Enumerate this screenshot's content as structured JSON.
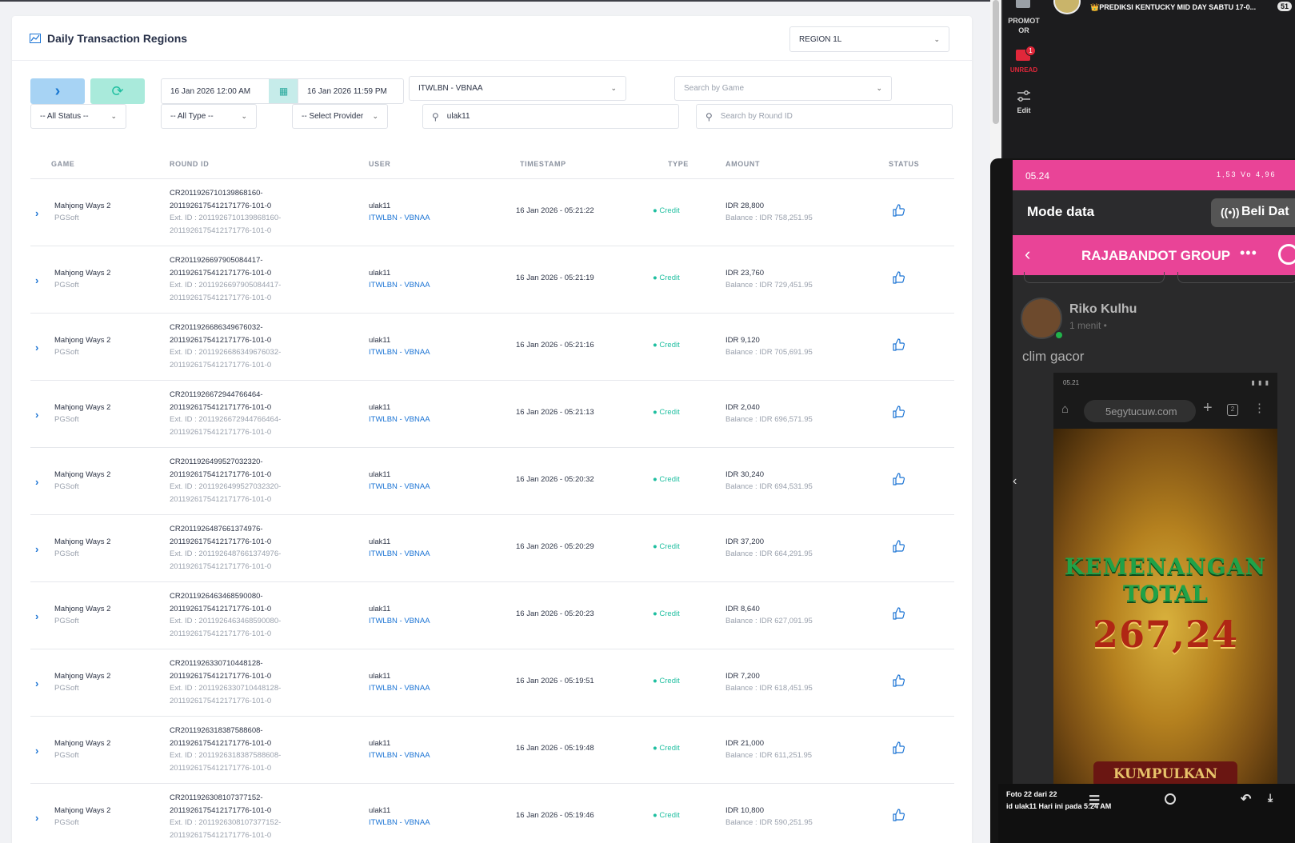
{
  "panel": {
    "title": "Daily Transaction Regions",
    "region_select": "REGION 1L"
  },
  "filters": {
    "date_start": "16 Jan 2026 12:00 AM",
    "date_end": "16 Jan 2026 11:59 PM",
    "agent_select": "ITWLBN - VBNAA",
    "game_search_placeholder": "Search by Game",
    "status_select": "-- All Status --",
    "type_select": "-- All Type --",
    "provider_select": "-- Select Provider",
    "user_search_value": "ulak11",
    "round_search_placeholder": "Search by Round ID"
  },
  "table": {
    "headers": [
      "GAME",
      "ROUND ID",
      "USER",
      "TIMESTAMP",
      "TYPE",
      "AMOUNT",
      "STATUS"
    ],
    "rows": [
      {
        "game": "Mahjong Ways 2",
        "provider": "PGSoft",
        "round1": "CR2011926710139868160-",
        "round2": "2011926175412171776-101-0",
        "ext1": "Ext. ID : 2011926710139868160-",
        "ext2": "2011926175412171776-101-0",
        "user": "ulak11",
        "group": "ITWLBN - VBNAA",
        "timestamp": "16 Jan 2026 - 05:21:22",
        "type": "Credit",
        "amount": "IDR 28,800",
        "balance": "Balance : IDR 758,251.95"
      },
      {
        "game": "Mahjong Ways 2",
        "provider": "PGSoft",
        "round1": "CR2011926697905084417-",
        "round2": "2011926175412171776-101-0",
        "ext1": "Ext. ID : 2011926697905084417-",
        "ext2": "2011926175412171776-101-0",
        "user": "ulak11",
        "group": "ITWLBN - VBNAA",
        "timestamp": "16 Jan 2026 - 05:21:19",
        "type": "Credit",
        "amount": "IDR 23,760",
        "balance": "Balance : IDR 729,451.95"
      },
      {
        "game": "Mahjong Ways 2",
        "provider": "PGSoft",
        "round1": "CR2011926686349676032-",
        "round2": "2011926175412171776-101-0",
        "ext1": "Ext. ID : 2011926686349676032-",
        "ext2": "2011926175412171776-101-0",
        "user": "ulak11",
        "group": "ITWLBN - VBNAA",
        "timestamp": "16 Jan 2026 - 05:21:16",
        "type": "Credit",
        "amount": "IDR 9,120",
        "balance": "Balance : IDR 705,691.95"
      },
      {
        "game": "Mahjong Ways 2",
        "provider": "PGSoft",
        "round1": "CR2011926672944766464-",
        "round2": "2011926175412171776-101-0",
        "ext1": "Ext. ID : 2011926672944766464-",
        "ext2": "2011926175412171776-101-0",
        "user": "ulak11",
        "group": "ITWLBN - VBNAA",
        "timestamp": "16 Jan 2026 - 05:21:13",
        "type": "Credit",
        "amount": "IDR 2,040",
        "balance": "Balance : IDR 696,571.95"
      },
      {
        "game": "Mahjong Ways 2",
        "provider": "PGSoft",
        "round1": "CR2011926499527032320-",
        "round2": "2011926175412171776-101-0",
        "ext1": "Ext. ID : 2011926499527032320-",
        "ext2": "2011926175412171776-101-0",
        "user": "ulak11",
        "group": "ITWLBN - VBNAA",
        "timestamp": "16 Jan 2026 - 05:20:32",
        "type": "Credit",
        "amount": "IDR 30,240",
        "balance": "Balance : IDR 694,531.95"
      },
      {
        "game": "Mahjong Ways 2",
        "provider": "PGSoft",
        "round1": "CR2011926487661374976-",
        "round2": "2011926175412171776-101-0",
        "ext1": "Ext. ID : 2011926487661374976-",
        "ext2": "2011926175412171776-101-0",
        "user": "ulak11",
        "group": "ITWLBN - VBNAA",
        "timestamp": "16 Jan 2026 - 05:20:29",
        "type": "Credit",
        "amount": "IDR 37,200",
        "balance": "Balance : IDR 664,291.95"
      },
      {
        "game": "Mahjong Ways 2",
        "provider": "PGSoft",
        "round1": "CR2011926463468590080-",
        "round2": "2011926175412171776-101-0",
        "ext1": "Ext. ID : 2011926463468590080-",
        "ext2": "2011926175412171776-101-0",
        "user": "ulak11",
        "group": "ITWLBN - VBNAA",
        "timestamp": "16 Jan 2026 - 05:20:23",
        "type": "Credit",
        "amount": "IDR 8,640",
        "balance": "Balance : IDR 627,091.95"
      },
      {
        "game": "Mahjong Ways 2",
        "provider": "PGSoft",
        "round1": "CR2011926330710448128-",
        "round2": "2011926175412171776-101-0",
        "ext1": "Ext. ID : 2011926330710448128-",
        "ext2": "2011926175412171776-101-0",
        "user": "ulak11",
        "group": "ITWLBN - VBNAA",
        "timestamp": "16 Jan 2026 - 05:19:51",
        "type": "Credit",
        "amount": "IDR 7,200",
        "balance": "Balance : IDR 618,451.95"
      },
      {
        "game": "Mahjong Ways 2",
        "provider": "PGSoft",
        "round1": "CR2011926318387588608-",
        "round2": "2011926175412171776-101-0",
        "ext1": "Ext. ID : 2011926318387588608-",
        "ext2": "2011926175412171776-101-0",
        "user": "ulak11",
        "group": "ITWLBN - VBNAA",
        "timestamp": "16 Jan 2026 - 05:19:48",
        "type": "Credit",
        "amount": "IDR 21,000",
        "balance": "Balance : IDR 611,251.95"
      },
      {
        "game": "Mahjong Ways 2",
        "provider": "PGSoft",
        "round1": "CR2011926308107377152-",
        "round2": "2011926175412171776-101-0",
        "ext1": "Ext. ID : 2011926308107377152-",
        "ext2": "2011926175412171776-101-0",
        "user": "ulak11",
        "group": "ITWLBN - VBNAA",
        "timestamp": "16 Jan 2026 - 05:19:46",
        "type": "Credit",
        "amount": "IDR 10,800",
        "balance": "Balance : IDR 590,251.95"
      }
    ]
  },
  "side_nav": {
    "promotor": "PROMOT\nOR",
    "unread": "UNREAD",
    "unread_count": "1",
    "edit": "Edit"
  },
  "chat_top": {
    "title": "👑PREDIKSI KENTUCKY MID DAY  SABTU 17-0...",
    "count": "51"
  },
  "phone": {
    "status_time": "05.24",
    "status_icons": "1,53 Vo 4,96",
    "mode_label": "Mode data",
    "beli_label": "Beli Dat",
    "group_title": "RAJABANDOT GROUP",
    "sender": "Riko Kulhu",
    "sent_time": "1 menit •",
    "message": "clim gacor",
    "inner_time": "05.21",
    "inner_url": "5egytucuw.com",
    "inner_tabs": "2",
    "win_line1": "KEMENANGAN",
    "win_line2": "TOTAL",
    "win_amount": "267,24",
    "collect": "KUMPULKAN"
  },
  "viewer": {
    "photo_label": "Foto 22 dari 22",
    "photo_meta": "id ulak11   Hari ini pada 5:24 AM"
  },
  "colors": {
    "accent_blue": "#1a73d4",
    "accent_teal": "#1fbfa0",
    "phone_pink": "#e94497"
  }
}
